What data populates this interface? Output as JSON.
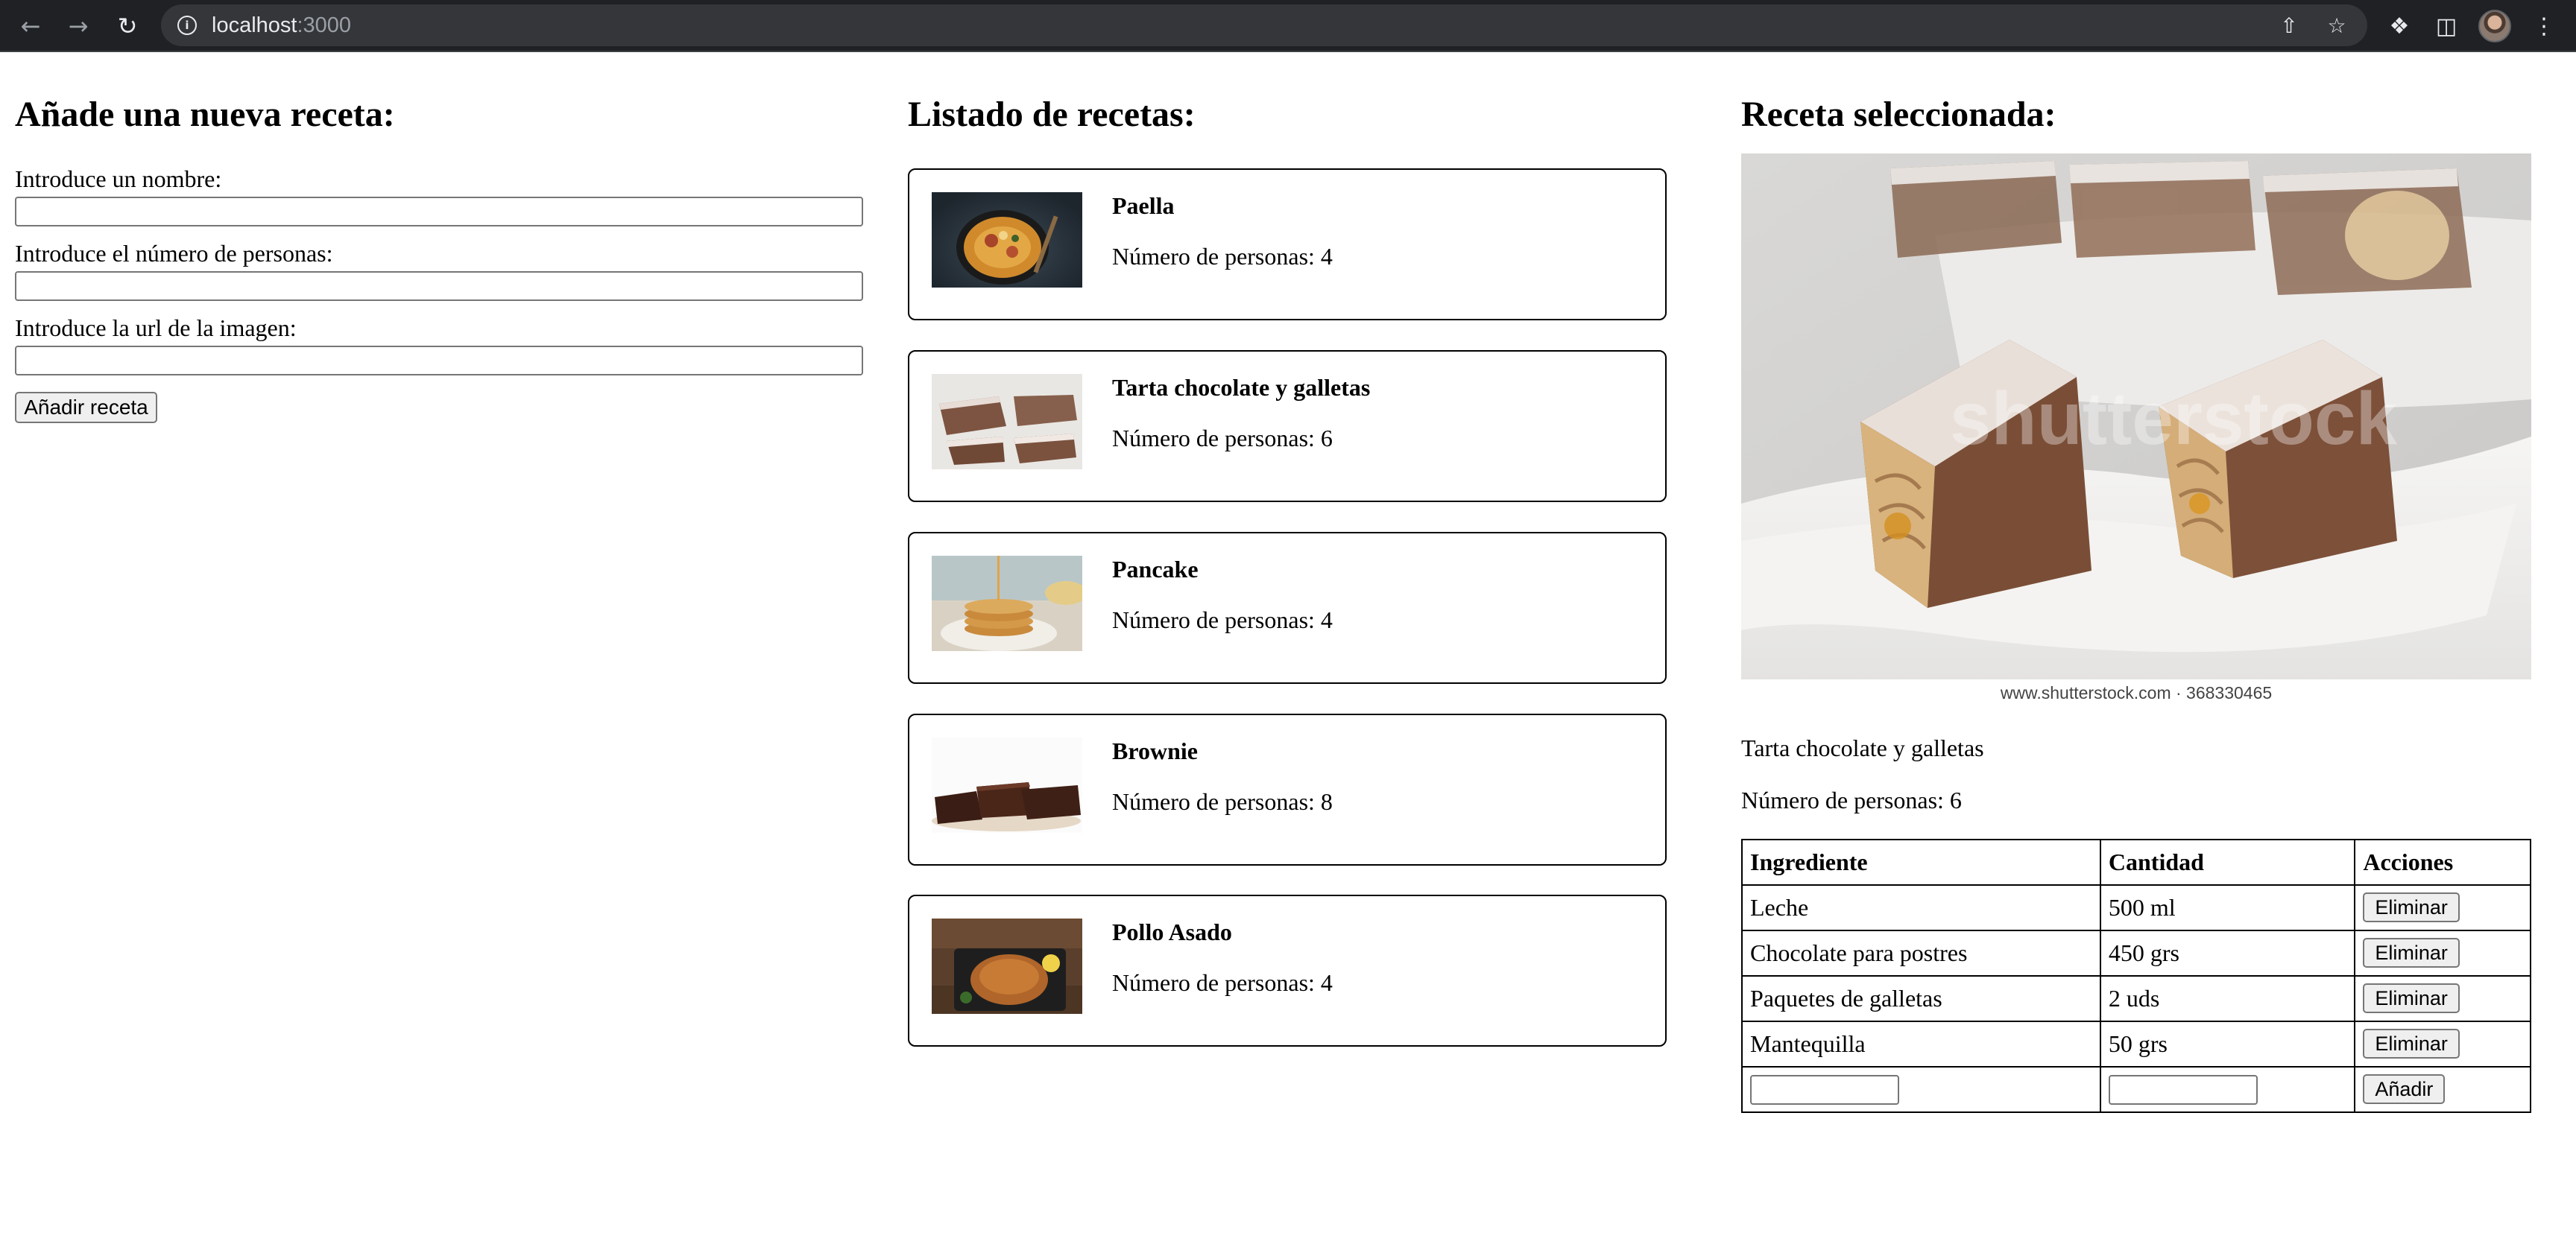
{
  "browser": {
    "url_host": "localhost",
    "url_port": ":3000"
  },
  "form": {
    "title": "Añade una nueva receta:",
    "name_label": "Introduce un nombre:",
    "name_value": "",
    "people_label": "Introduce el número de personas:",
    "people_value": "",
    "image_label": "Introduce la url de la imagen:",
    "image_value": "",
    "submit_label": "Añadir receta"
  },
  "list": {
    "title": "Listado de recetas:",
    "recipes": [
      {
        "name": "Paella",
        "people": "Número de personas: 4",
        "image": "paella-photo"
      },
      {
        "name": "Tarta chocolate y galletas",
        "people": "Número de personas: 6",
        "image": "chocolate-cake-photo"
      },
      {
        "name": "Pancake",
        "people": "Número de personas: 4",
        "image": "pancake-photo"
      },
      {
        "name": "Brownie",
        "people": "Número de personas: 8",
        "image": "brownie-photo"
      },
      {
        "name": "Pollo Asado",
        "people": "Número de personas: 4",
        "image": "roast-chicken-photo"
      }
    ]
  },
  "selected": {
    "title": "Receta seleccionada:",
    "image_caption": "www.shutterstock.com · 368330465",
    "watermark": "shutterstock",
    "name": "Tarta chocolate y galletas",
    "people": "Número de personas: 6",
    "table": {
      "headers": [
        "Ingrediente",
        "Cantidad",
        "Acciones"
      ],
      "rows": [
        {
          "ingredient": "Leche",
          "quantity": "500 ml",
          "action": "Eliminar"
        },
        {
          "ingredient": "Chocolate para postres",
          "quantity": "450 grs",
          "action": "Eliminar"
        },
        {
          "ingredient": "Paquetes de galletas",
          "quantity": "2 uds",
          "action": "Eliminar"
        },
        {
          "ingredient": "Mantequilla",
          "quantity": "50 grs",
          "action": "Eliminar"
        }
      ],
      "new_ingredient_value": "",
      "new_quantity_value": "",
      "add_label": "Añadir"
    }
  },
  "colors": {
    "chrome_bg": "#202124",
    "omnibox_bg": "#35363a",
    "border": "#000000",
    "button_bg": "#efefef"
  }
}
